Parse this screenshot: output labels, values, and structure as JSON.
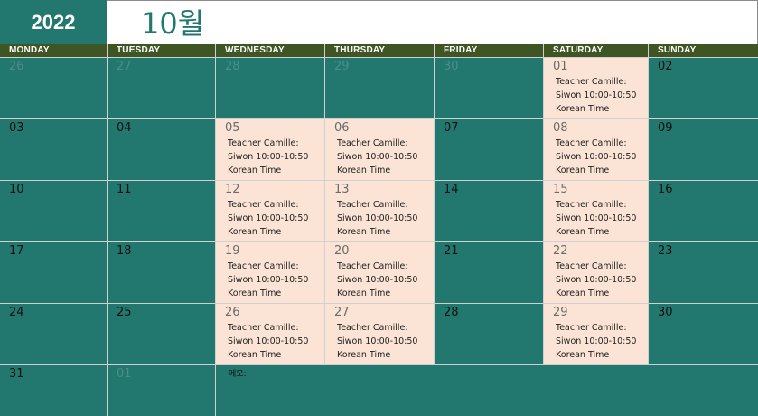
{
  "header": {
    "year": "2022",
    "month": "10월"
  },
  "weekdays": [
    "MONDAY",
    "TUESDAY",
    "WEDNESDAY",
    "THURSDAY",
    "FRIDAY",
    "SATURDAY",
    "SUNDAY"
  ],
  "event": {
    "line1": "Teacher Camille:",
    "line2": "Siwon 10:00-10:50",
    "line3": "Korean Time"
  },
  "weeks": [
    [
      {
        "day": "26",
        "other": true
      },
      {
        "day": "27",
        "other": true
      },
      {
        "day": "28",
        "other": true
      },
      {
        "day": "29",
        "other": true
      },
      {
        "day": "30",
        "other": true
      },
      {
        "day": "01",
        "event": true
      },
      {
        "day": "02"
      }
    ],
    [
      {
        "day": "03"
      },
      {
        "day": "04"
      },
      {
        "day": "05",
        "event": true
      },
      {
        "day": "06",
        "event": true
      },
      {
        "day": "07"
      },
      {
        "day": "08",
        "event": true
      },
      {
        "day": "09"
      }
    ],
    [
      {
        "day": "10"
      },
      {
        "day": "11"
      },
      {
        "day": "12",
        "event": true
      },
      {
        "day": "13",
        "event": true
      },
      {
        "day": "14"
      },
      {
        "day": "15",
        "event": true
      },
      {
        "day": "16"
      }
    ],
    [
      {
        "day": "17"
      },
      {
        "day": "18"
      },
      {
        "day": "19",
        "event": true
      },
      {
        "day": "20",
        "event": true
      },
      {
        "day": "21"
      },
      {
        "day": "22",
        "event": true
      },
      {
        "day": "23"
      }
    ],
    [
      {
        "day": "24"
      },
      {
        "day": "25"
      },
      {
        "day": "26",
        "event": true
      },
      {
        "day": "27",
        "event": true
      },
      {
        "day": "28"
      },
      {
        "day": "29",
        "event": true
      },
      {
        "day": "30"
      }
    ],
    [
      {
        "day": "31"
      },
      {
        "day": "01",
        "other": true
      }
    ]
  ],
  "memo": {
    "label": "메모:"
  },
  "colors": {
    "teal": "#22776e",
    "header_bar": "#3f5524",
    "event_fill": "#fbe4d5"
  }
}
